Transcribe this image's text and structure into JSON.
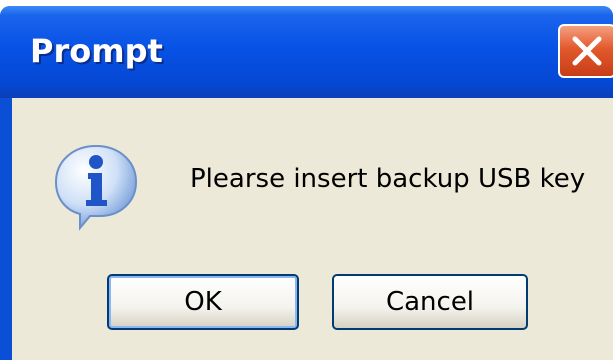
{
  "window": {
    "title": "Prompt",
    "close_icon": "close-icon"
  },
  "dialog": {
    "icon": "info-icon",
    "message": "Plearse insert backup USB key"
  },
  "buttons": {
    "ok_label": "OK",
    "cancel_label": "Cancel"
  },
  "colors": {
    "titlebar": "#0852e6",
    "client_background": "#ece9d8",
    "close_button": "#e2592d",
    "button_border": "#003c74",
    "info_icon": "#1f55c6"
  }
}
